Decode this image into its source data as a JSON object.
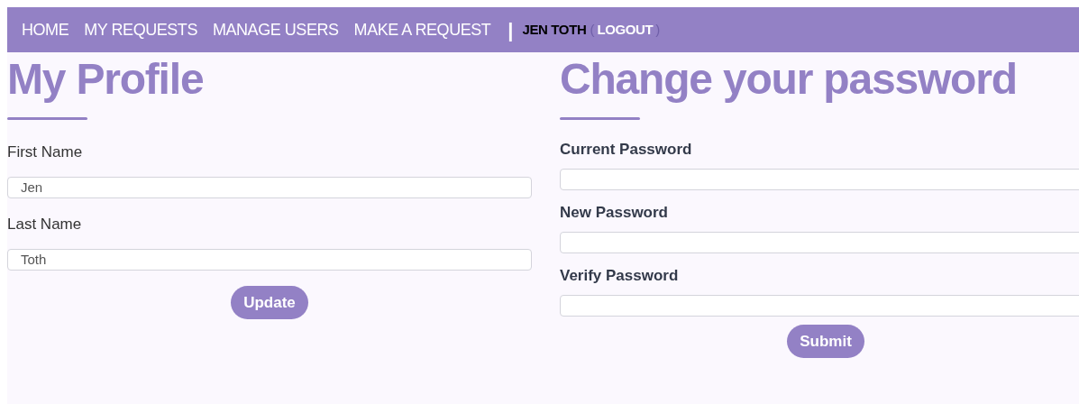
{
  "nav": {
    "links": [
      "HOME",
      "MY REQUESTS",
      "MANAGE USERS",
      "MAKE A REQUEST"
    ],
    "separator": "|",
    "user": "JEN TOTH",
    "open_paren": "(",
    "logout": "LOGOUT",
    "close_paren": ")"
  },
  "profile": {
    "title": "My Profile",
    "fields": [
      {
        "label": "First Name",
        "value": "Jen"
      },
      {
        "label": "Last Name",
        "value": "Toth"
      }
    ],
    "button": "Update"
  },
  "password": {
    "title": "Change your password",
    "fields": [
      {
        "label": "Current Password"
      },
      {
        "label": "New Password"
      },
      {
        "label": "Verify Password"
      }
    ],
    "button": "Submit"
  }
}
